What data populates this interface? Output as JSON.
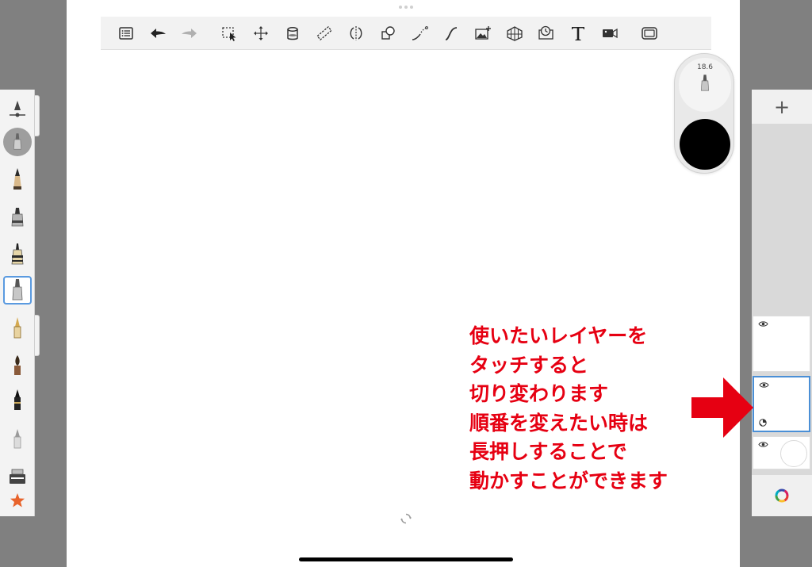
{
  "toolbar": {
    "tools": [
      "menu",
      "undo",
      "redo",
      "selection",
      "transform",
      "fill",
      "ruler",
      "symmetry",
      "shapes",
      "curve-stroke",
      "perspective-stroke",
      "import-image",
      "perspective-grid",
      "time-lapse",
      "text",
      "record-video",
      "fullscreen"
    ]
  },
  "brush_palette": {
    "brushes": [
      "pencil",
      "marker",
      "ballpoint",
      "paint-brush",
      "fountain-pen",
      "watercolor-brush",
      "ink-brush",
      "airbrush",
      "eraser",
      "brush-library",
      "favorites"
    ],
    "selected_brush": "paint-brush"
  },
  "puck": {
    "brush_size": "18.6",
    "current_color": "#000000"
  },
  "layers": {
    "add_label": "+",
    "items": [
      {
        "name": "layer-top",
        "visible": true,
        "selected": false
      },
      {
        "name": "layer-middle",
        "visible": true,
        "selected": true
      },
      {
        "name": "layer-background",
        "visible": true,
        "selected": false
      }
    ]
  },
  "annotation": {
    "lines": [
      "使いたいレイヤーを",
      "タッチすると",
      "切り変わります",
      "順番を変えたい時は",
      "長押しすることで",
      "動かすことができます"
    ],
    "color": "#e60012"
  },
  "colors": {
    "accent": "#4a8fd6",
    "background": "#808080",
    "canvas": "#ffffff"
  }
}
